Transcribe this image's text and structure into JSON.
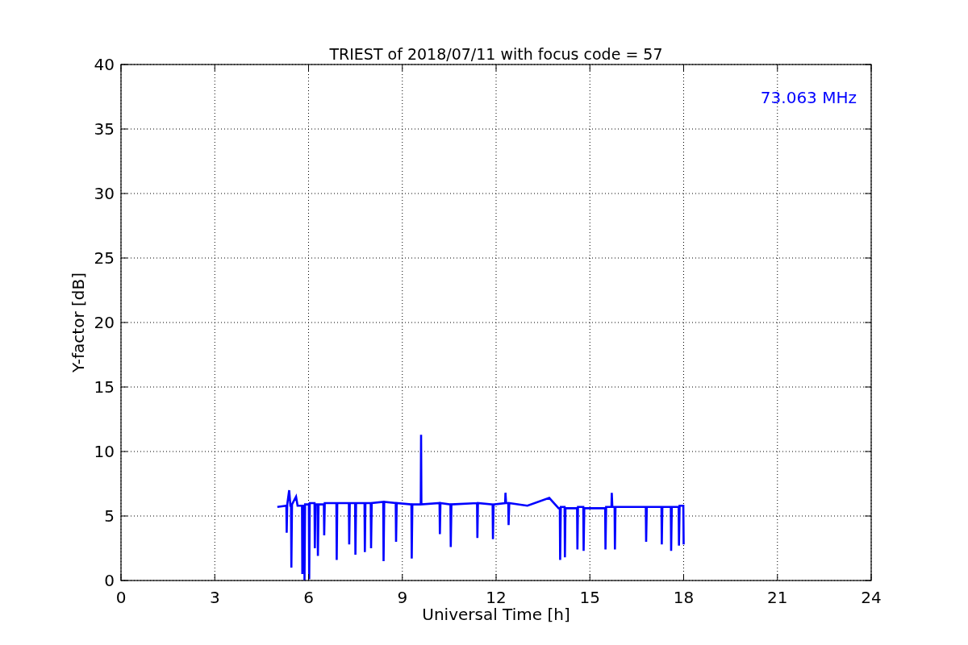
{
  "figure": {
    "chart_data": {
      "type": "line",
      "title": "TRIEST of 2018/07/11 with focus code = 57",
      "xlabel": "Universal Time [h]",
      "ylabel": "Y-factor [dB]",
      "xlim": [
        0,
        24
      ],
      "ylim": [
        0,
        40
      ],
      "grid": true,
      "xticks": [
        0,
        3,
        6,
        9,
        12,
        15,
        18,
        21,
        24
      ],
      "yticks": [
        0,
        5,
        10,
        15,
        20,
        25,
        30,
        35,
        40
      ],
      "series": [
        {
          "name": "73.063 MHz",
          "color": "#0000ff",
          "x": [
            5.0,
            5.29,
            5.3,
            5.32,
            5.38,
            5.42,
            5.44,
            5.45,
            5.47,
            5.6,
            5.65,
            5.79,
            5.8,
            5.82,
            5.86,
            5.87,
            5.89,
            6.01,
            6.02,
            6.04,
            6.19,
            6.2,
            6.22,
            6.29,
            6.3,
            6.32,
            6.49,
            6.5,
            6.52,
            6.89,
            6.9,
            6.92,
            7.29,
            7.3,
            7.32,
            7.49,
            7.5,
            7.52,
            7.79,
            7.8,
            7.82,
            7.99,
            8.0,
            8.02,
            8.39,
            8.4,
            8.42,
            8.79,
            8.8,
            8.82,
            9.29,
            9.3,
            9.32,
            9.59,
            9.6,
            9.61,
            10.19,
            10.2,
            10.22,
            10.54,
            10.55,
            10.57,
            11.39,
            11.4,
            11.42,
            11.89,
            11.9,
            11.92,
            12.29,
            12.3,
            12.32,
            12.39,
            12.4,
            12.42,
            13.0,
            13.7,
            14.0,
            14.04,
            14.05,
            14.07,
            14.19,
            14.2,
            14.22,
            14.59,
            14.6,
            14.62,
            14.79,
            14.8,
            14.82,
            15.49,
            15.5,
            15.52,
            15.69,
            15.7,
            15.72,
            15.79,
            15.8,
            15.82,
            16.79,
            16.8,
            16.82,
            17.29,
            17.3,
            17.32,
            17.59,
            17.6,
            17.62,
            17.84,
            17.85,
            17.87,
            17.99,
            18.0
          ],
          "values": [
            5.7,
            5.8,
            3.7,
            5.9,
            7.0,
            5.8,
            5.8,
            1.0,
            5.9,
            6.5,
            5.8,
            5.8,
            0.5,
            5.8,
            5.8,
            0,
            5.9,
            5.9,
            0.1,
            6.0,
            6.0,
            2.5,
            5.9,
            5.9,
            1.9,
            5.9,
            5.9,
            3.5,
            6.0,
            6.0,
            1.6,
            6.0,
            6.0,
            2.8,
            6.0,
            6.0,
            2.0,
            6.0,
            6.0,
            2.2,
            6.0,
            6.0,
            2.5,
            6.0,
            6.1,
            1.5,
            6.1,
            6.0,
            3.0,
            6.0,
            5.9,
            1.7,
            5.9,
            5.9,
            11.3,
            5.9,
            6.0,
            3.6,
            6.0,
            5.9,
            2.6,
            5.9,
            6.0,
            3.3,
            6.0,
            5.9,
            3.2,
            5.9,
            6.0,
            6.8,
            6.0,
            6.0,
            4.3,
            6.0,
            5.8,
            6.4,
            5.6,
            5.6,
            1.6,
            5.7,
            5.7,
            1.8,
            5.6,
            5.6,
            2.4,
            5.7,
            5.7,
            2.3,
            5.6,
            5.6,
            2.4,
            5.7,
            5.7,
            6.8,
            5.7,
            5.7,
            2.4,
            5.7,
            5.7,
            3.0,
            5.7,
            5.7,
            2.8,
            5.7,
            5.7,
            2.3,
            5.7,
            5.7,
            2.7,
            5.8,
            5.8,
            2.8
          ]
        }
      ]
    }
  }
}
